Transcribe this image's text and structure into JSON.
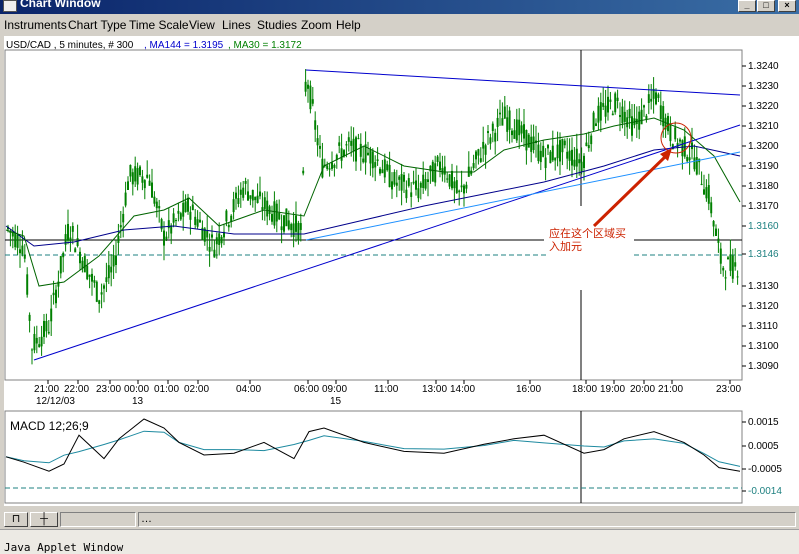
{
  "window": {
    "title": "Chart Window"
  },
  "menu": [
    "Instruments",
    "Chart Type",
    "Time Scale",
    "View",
    "Lines",
    "Studies",
    "Zoom",
    "Help"
  ],
  "chart": {
    "header": {
      "symbol": "USD/CAD , 5 minutes, # 300",
      "ma144": ", MA144 = 1.3195",
      "ma30": ", MA30 = 1.3172"
    },
    "y_ticks": [
      "1.3240",
      "1.3230",
      "1.3220",
      "1.3210",
      "1.3200",
      "1.3190",
      "1.3180",
      "1.3170",
      "1.3160",
      "1.3146",
      "1.3130",
      "1.3120",
      "1.3110",
      "1.3100",
      "1.3090"
    ],
    "x_ticks": [
      "21:00",
      "22:00",
      "23:00",
      "00:00",
      "01:00",
      "02:00",
      "04:00",
      "06:00",
      "09:00",
      "11:00",
      "13:00",
      "14:00",
      "16:00",
      "18:00",
      "19:00",
      "20:00",
      "21:00",
      "23:00"
    ],
    "date_labels": [
      "12/12/03",
      "13",
      "15"
    ],
    "annotation": {
      "line1": "应在这个区域买",
      "line2": "入加元"
    },
    "colors": {
      "candle": "#008000",
      "ma144": "#00008b",
      "ma30": "#006400",
      "trend": "#0000cd",
      "highlight": "#1e90ff",
      "arrow": "#cc2200"
    }
  },
  "chart_data": {
    "type": "line",
    "title": "USD/CAD , 5 minutes, # 300",
    "xlabel": "",
    "ylabel": "",
    "ylim": [
      1.3085,
      1.325
    ],
    "x": [
      "21:00",
      "22:00",
      "23:00",
      "00:00",
      "01:00",
      "02:00",
      "04:00",
      "06:00",
      "09:00",
      "11:00",
      "13:00",
      "14:00",
      "16:00",
      "18:00",
      "19:00",
      "20:00",
      "21:00",
      "23:00"
    ],
    "series": [
      {
        "name": "MA144 = 1.3195",
        "values": [
          1.316,
          1.315,
          1.315,
          1.3156,
          1.3158,
          1.3157,
          1.3155,
          1.3156,
          1.3162,
          1.3167,
          1.3172,
          1.3176,
          1.318,
          1.3186,
          1.319,
          1.3194,
          1.3198,
          1.3195
        ]
      },
      {
        "name": "MA30 = 1.3172",
        "values": [
          1.311,
          1.3135,
          1.315,
          1.3168,
          1.317,
          1.316,
          1.3162,
          1.317,
          1.3195,
          1.319,
          1.3185,
          1.319,
          1.32,
          1.3202,
          1.321,
          1.3212,
          1.32,
          1.3172
        ]
      }
    ],
    "macd": {
      "label": "MACD 12;26;9",
      "y_ticks": [
        "0.0015",
        "0.0005",
        "-0.0005",
        "-0.0014"
      ]
    }
  }
}
